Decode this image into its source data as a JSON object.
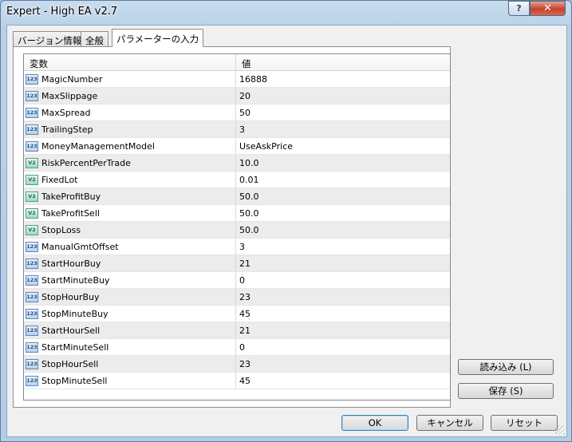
{
  "window": {
    "title": "Expert - High EA v2.7",
    "help_label": "?",
    "close_label": "✕"
  },
  "tabs": [
    {
      "label": "バージョン情報"
    },
    {
      "label": "全般"
    },
    {
      "label": "パラメーターの入力",
      "active": true
    }
  ],
  "grid": {
    "col_variable": "変数",
    "col_value": "値",
    "rows": [
      {
        "name": "MagicNumber",
        "value": "16888",
        "type": "int",
        "icon": "int-type-icon",
        "icon_text": "123"
      },
      {
        "name": "MaxSlippage",
        "value": "20",
        "type": "int",
        "icon": "int-type-icon",
        "icon_text": "123"
      },
      {
        "name": "MaxSpread",
        "value": "50",
        "type": "int",
        "icon": "int-type-icon",
        "icon_text": "123"
      },
      {
        "name": "TrailingStep",
        "value": "3",
        "type": "int",
        "icon": "int-type-icon",
        "icon_text": "123"
      },
      {
        "name": "MoneyManagementModel",
        "value": "UseAskPrice",
        "type": "int",
        "icon": "int-type-icon",
        "icon_text": "123"
      },
      {
        "name": "RiskPercentPerTrade",
        "value": "10.0",
        "type": "double",
        "icon": "double-type-icon",
        "icon_text": "V2"
      },
      {
        "name": "FixedLot",
        "value": "0.01",
        "type": "double",
        "icon": "double-type-icon",
        "icon_text": "V2"
      },
      {
        "name": "TakeProfitBuy",
        "value": "50.0",
        "type": "double",
        "icon": "double-type-icon",
        "icon_text": "V2"
      },
      {
        "name": "TakeProfitSell",
        "value": "50.0",
        "type": "double",
        "icon": "double-type-icon",
        "icon_text": "V2"
      },
      {
        "name": "StopLoss",
        "value": "50.0",
        "type": "double",
        "icon": "double-type-icon",
        "icon_text": "V2"
      },
      {
        "name": "ManualGmtOffset",
        "value": "3",
        "type": "int",
        "icon": "int-type-icon",
        "icon_text": "123"
      },
      {
        "name": "StartHourBuy",
        "value": "21",
        "type": "int",
        "icon": "int-type-icon",
        "icon_text": "123"
      },
      {
        "name": "StartMinuteBuy",
        "value": "0",
        "type": "int",
        "icon": "int-type-icon",
        "icon_text": "123"
      },
      {
        "name": "StopHourBuy",
        "value": "23",
        "type": "int",
        "icon": "int-type-icon",
        "icon_text": "123"
      },
      {
        "name": "StopMinuteBuy",
        "value": "45",
        "type": "int",
        "icon": "int-type-icon",
        "icon_text": "123"
      },
      {
        "name": "StartHourSell",
        "value": "21",
        "type": "int",
        "icon": "int-type-icon",
        "icon_text": "123"
      },
      {
        "name": "StartMinuteSell",
        "value": "0",
        "type": "int",
        "icon": "int-type-icon",
        "icon_text": "123"
      },
      {
        "name": "StopHourSell",
        "value": "23",
        "type": "int",
        "icon": "int-type-icon",
        "icon_text": "123"
      },
      {
        "name": "StopMinuteSell",
        "value": "45",
        "type": "int",
        "icon": "int-type-icon",
        "icon_text": "123"
      }
    ]
  },
  "side_buttons": {
    "load_label": "読み込み (L)",
    "save_label": "保存 (S)"
  },
  "bottom_buttons": {
    "ok_label": "OK",
    "cancel_label": "キャンセル",
    "reset_label": "リセット"
  }
}
